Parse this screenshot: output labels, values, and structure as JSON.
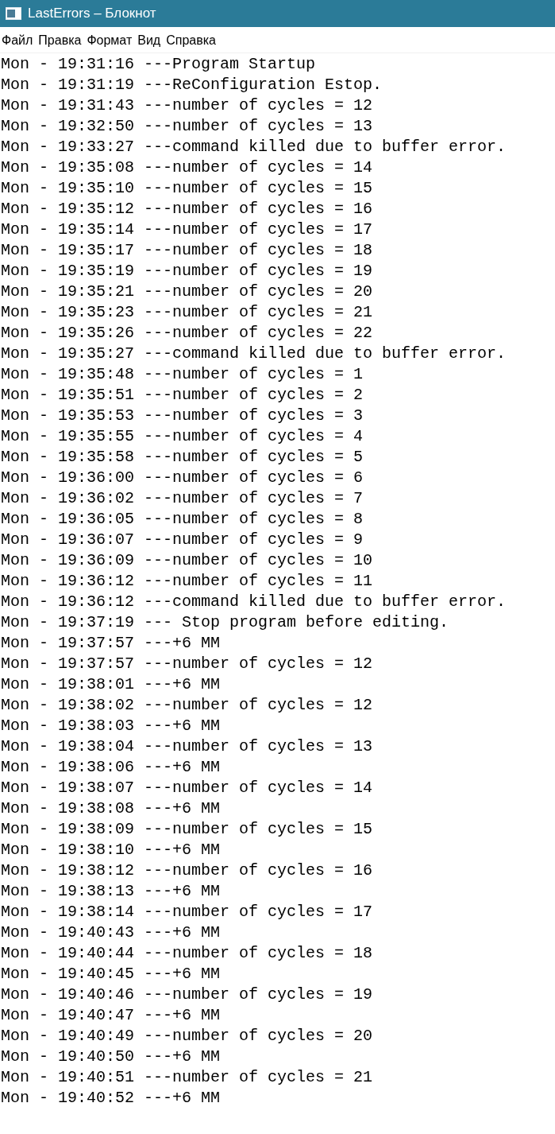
{
  "window": {
    "title": "LastErrors – Блокнот"
  },
  "menu": [
    "Файл",
    "Правка",
    "Формат",
    "Вид",
    "Справка"
  ],
  "lines": [
    "Mon - 19:31:16 ---Program Startup",
    "Mon - 19:31:19 ---ReConfiguration Estop.",
    "Mon - 19:31:43 ---number of cycles = 12",
    "Mon - 19:32:50 ---number of cycles = 13",
    "Mon - 19:33:27 ---command killed due to buffer error.",
    "Mon - 19:35:08 ---number of cycles = 14",
    "Mon - 19:35:10 ---number of cycles = 15",
    "Mon - 19:35:12 ---number of cycles = 16",
    "Mon - 19:35:14 ---number of cycles = 17",
    "Mon - 19:35:17 ---number of cycles = 18",
    "Mon - 19:35:19 ---number of cycles = 19",
    "Mon - 19:35:21 ---number of cycles = 20",
    "Mon - 19:35:23 ---number of cycles = 21",
    "Mon - 19:35:26 ---number of cycles = 22",
    "Mon - 19:35:27 ---command killed due to buffer error.",
    "Mon - 19:35:48 ---number of cycles = 1",
    "Mon - 19:35:51 ---number of cycles = 2",
    "Mon - 19:35:53 ---number of cycles = 3",
    "Mon - 19:35:55 ---number of cycles = 4",
    "Mon - 19:35:58 ---number of cycles = 5",
    "Mon - 19:36:00 ---number of cycles = 6",
    "Mon - 19:36:02 ---number of cycles = 7",
    "Mon - 19:36:05 ---number of cycles = 8",
    "Mon - 19:36:07 ---number of cycles = 9",
    "Mon - 19:36:09 ---number of cycles = 10",
    "Mon - 19:36:12 ---number of cycles = 11",
    "Mon - 19:36:12 ---command killed due to buffer error.",
    "Mon - 19:37:19 --- Stop program before editing.",
    "Mon - 19:37:57 ---+6 MM",
    "Mon - 19:37:57 ---number of cycles = 12",
    "Mon - 19:38:01 ---+6 MM",
    "Mon - 19:38:02 ---number of cycles = 12",
    "Mon - 19:38:03 ---+6 MM",
    "Mon - 19:38:04 ---number of cycles = 13",
    "Mon - 19:38:06 ---+6 MM",
    "Mon - 19:38:07 ---number of cycles = 14",
    "Mon - 19:38:08 ---+6 MM",
    "Mon - 19:38:09 ---number of cycles = 15",
    "Mon - 19:38:10 ---+6 MM",
    "Mon - 19:38:12 ---number of cycles = 16",
    "Mon - 19:38:13 ---+6 MM",
    "Mon - 19:38:14 ---number of cycles = 17",
    "Mon - 19:40:43 ---+6 MM",
    "Mon - 19:40:44 ---number of cycles = 18",
    "Mon - 19:40:45 ---+6 MM",
    "Mon - 19:40:46 ---number of cycles = 19",
    "Mon - 19:40:47 ---+6 MM",
    "Mon - 19:40:49 ---number of cycles = 20",
    "Mon - 19:40:50 ---+6 MM",
    "Mon - 19:40:51 ---number of cycles = 21",
    "Mon - 19:40:52 ---+6 MM"
  ]
}
